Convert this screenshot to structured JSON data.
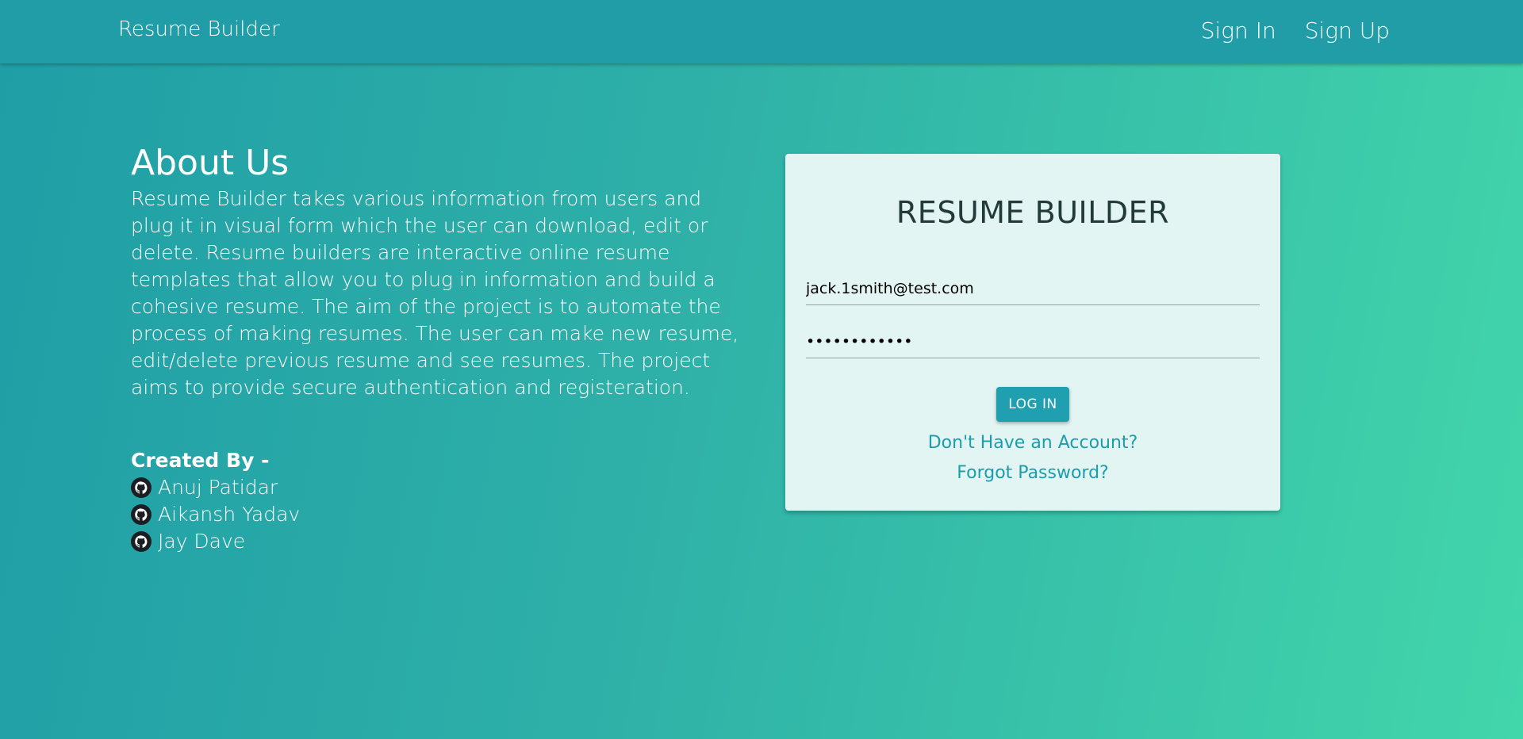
{
  "navbar": {
    "brand": "Resume Builder",
    "links": [
      "Sign In",
      "Sign Up"
    ]
  },
  "about": {
    "title": "About Us",
    "body": "Resume Builder takes various information from users and plug it in visual form which the user can download, edit or delete. Resume builders are interactive online resume templates that allow you to plug in information and build a cohesive resume. The aim of the project is to automate the process of making resumes. The user can make new resume, edit/delete previous resume and see resumes. The project aims to provide secure authentication and registeration.",
    "created_by": "Created By -",
    "authors": [
      {
        "name": "Anuj Patidar",
        "icon": "github-icon"
      },
      {
        "name": "Aikansh Yadav",
        "icon": "github-icon"
      },
      {
        "name": "Jay Dave",
        "icon": "github-icon"
      }
    ]
  },
  "login_card": {
    "title": "RESUME BUILDER",
    "email_value": "jack.1smith@test.com",
    "password_value": "••••••••••••",
    "login_label": "LOG IN",
    "signup_link": "Don't Have an Account?",
    "forgot_link": "Forgot Password?"
  },
  "colors": {
    "navbar": "#219da8",
    "gradient_start": "#1f9ea6",
    "gradient_end": "#42d6ab",
    "card_bg": "#e3f5f3",
    "accent": "#1f9fb0"
  }
}
